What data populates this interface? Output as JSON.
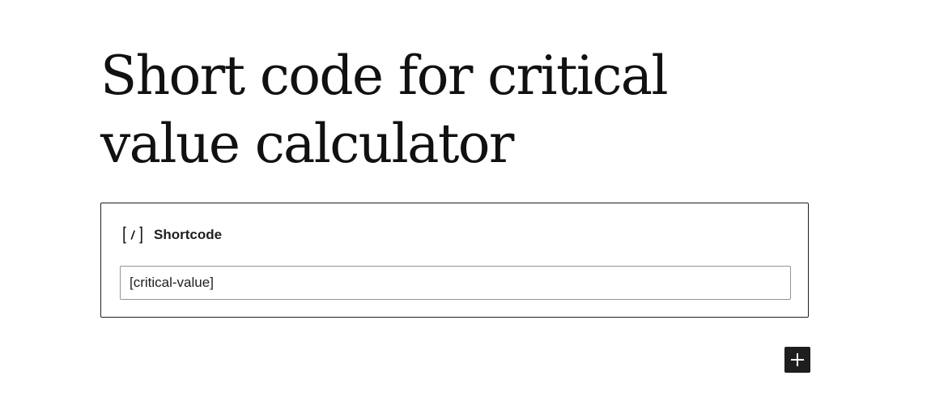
{
  "post": {
    "title": "Short code for critical value calculator"
  },
  "block": {
    "icon": "shortcode-icon",
    "label": "Shortcode",
    "input_value": "[critical-value]"
  },
  "inserter": {
    "icon": "plus-icon"
  }
}
